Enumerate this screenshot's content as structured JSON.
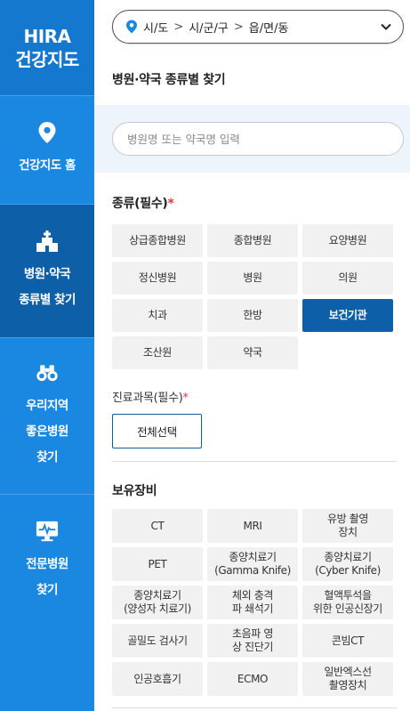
{
  "logo": {
    "line1": "HIRA",
    "line2": "건강지도"
  },
  "nav": {
    "home": "건강지도 홈",
    "hospital": "병원·약국\n종류별 찾기",
    "region": "우리지역\n좋은병원\n찾기",
    "special": "전문병원\n찾기"
  },
  "location": {
    "sido": "시/도",
    "sigungu": "시/군/구",
    "dong": "읍/면/동"
  },
  "page_title": "병원·약국 종류별 찾기",
  "search": {
    "placeholder": "병원명 또는 약국명 입력"
  },
  "type_section": {
    "title": "종류(필수)",
    "required_mark": "*"
  },
  "types": [
    {
      "label": "상급종합병원",
      "active": false
    },
    {
      "label": "종합병원",
      "active": false
    },
    {
      "label": "요양병원",
      "active": false
    },
    {
      "label": "정신병원",
      "active": false
    },
    {
      "label": "병원",
      "active": false
    },
    {
      "label": "의원",
      "active": false
    },
    {
      "label": "치과",
      "active": false
    },
    {
      "label": "한방",
      "active": false
    },
    {
      "label": "보건기관",
      "active": true
    },
    {
      "label": "조산원",
      "active": false
    },
    {
      "label": "약국",
      "active": false
    }
  ],
  "dept_section": {
    "title": "진료과목(필수)",
    "required_mark": "*",
    "select_all": "전체선택"
  },
  "equip_section": {
    "title": "보유장비"
  },
  "equipment": [
    "CT",
    "MRI",
    "유방 촬영\n장치",
    "PET",
    "종양치료기\n(Gamma Knife)",
    "종양치료기\n(Cyber Knife)",
    "종양치료기\n(양성자 치료기)",
    "체외 충격\n파 쇄석기",
    "혈액투석을\n위한 인공신장기",
    "골밀도 검사기",
    "초음파 영\n상 진단기",
    "콘빔CT",
    "인공호흡기",
    "ECMO",
    "일반엑스선\n촬영장치"
  ],
  "colors": {
    "sidebar": "#1a88e0",
    "sidebar_active": "#0d5fa8",
    "accent": "#0d5fa8",
    "required": "#e53935"
  }
}
